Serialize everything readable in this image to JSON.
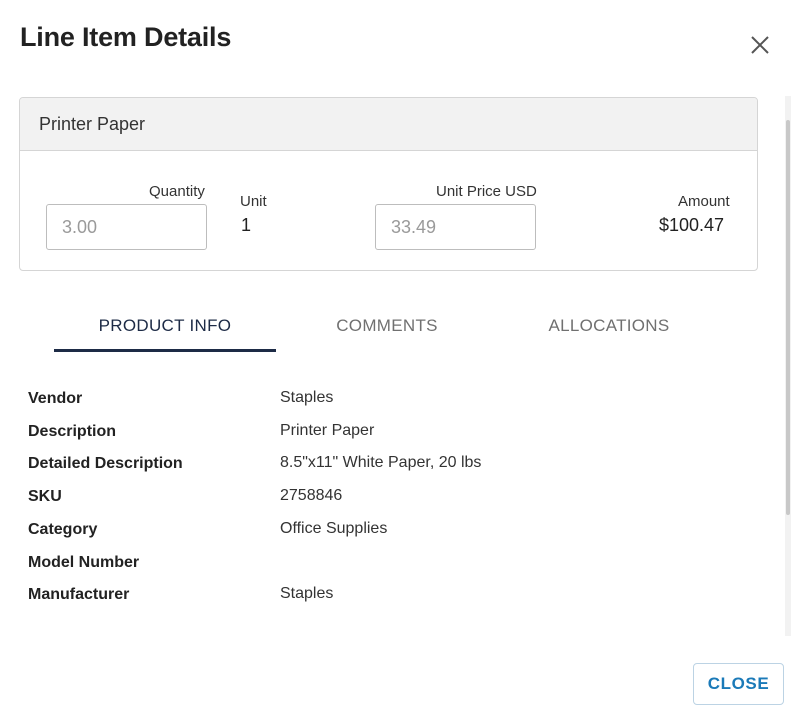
{
  "dialog": {
    "title": "Line Item Details",
    "close_icon": "close-icon",
    "close_button_label": "CLOSE"
  },
  "item": {
    "name": "Printer Paper",
    "quantity_label": "Quantity",
    "quantity_value": "3.00",
    "unit_label": "Unit",
    "unit_value": "1",
    "unit_price_label": "Unit Price USD",
    "unit_price_value": "33.49",
    "amount_label": "Amount",
    "amount_value": "$100.47"
  },
  "tabs": [
    {
      "label": "PRODUCT INFO",
      "active": true
    },
    {
      "label": "COMMENTS",
      "active": false
    },
    {
      "label": "ALLOCATIONS",
      "active": false
    }
  ],
  "product_info": [
    {
      "label": "Vendor",
      "value": "Staples"
    },
    {
      "label": "Description",
      "value": "Printer Paper"
    },
    {
      "label": "Detailed Description",
      "value": "8.5\"x11\" White Paper, 20 lbs"
    },
    {
      "label": "SKU",
      "value": "2758846"
    },
    {
      "label": "Category",
      "value": "Office Supplies"
    },
    {
      "label": "Model Number",
      "value": ""
    },
    {
      "label": "Manufacturer",
      "value": "Staples"
    }
  ],
  "colors": {
    "accent": "#1d2b46",
    "link": "#1b7ab8"
  }
}
